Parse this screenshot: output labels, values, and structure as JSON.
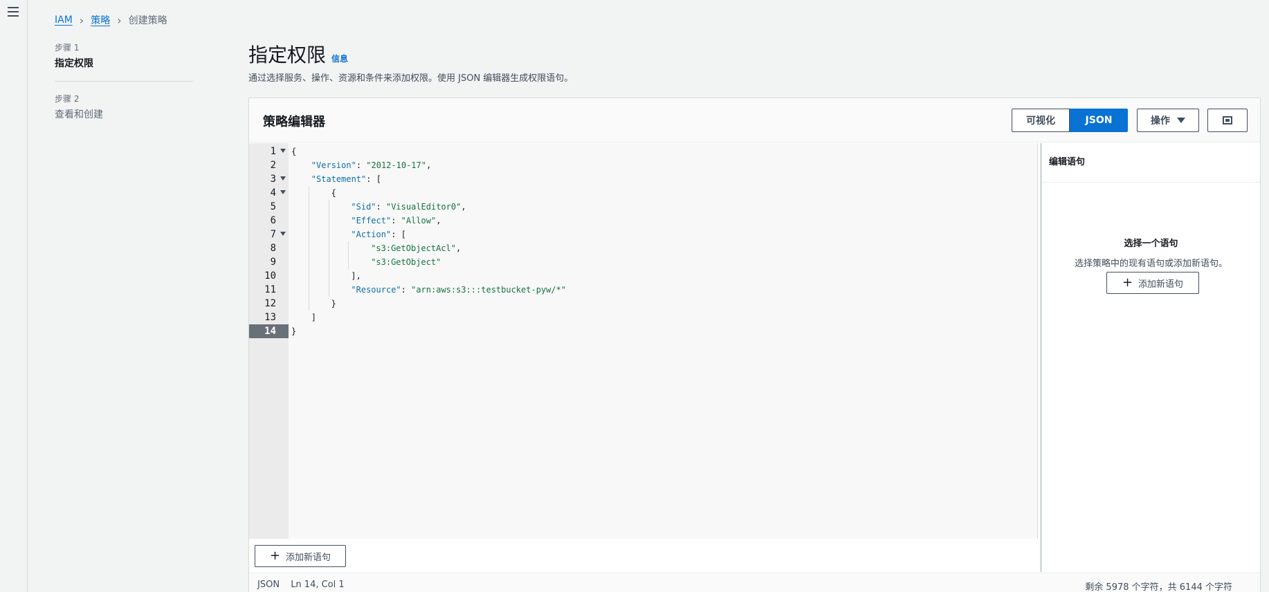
{
  "breadcrumb": {
    "iam": "IAM",
    "policies": "策略",
    "current": "创建策略"
  },
  "steps": [
    {
      "num": "步骤 1",
      "title": "指定权限"
    },
    {
      "num": "步骤 2",
      "title": "查看和创建"
    }
  ],
  "page": {
    "title": "指定权限",
    "info": "信息",
    "description": "通过选择服务、操作、资源和条件来添加权限。使用 JSON 编辑器生成权限语句。"
  },
  "editor": {
    "title": "策略编辑器",
    "tab_visual": "可视化",
    "tab_json": "JSON",
    "actions": "操作",
    "lines": [
      {
        "n": "1",
        "text": "{"
      },
      {
        "n": "2",
        "key": "\"Version\"",
        "sep": ": ",
        "val": "\"2012-10-17\"",
        "tail": ","
      },
      {
        "n": "3",
        "key": "\"Statement\"",
        "sep": ": [",
        "val": "",
        "tail": ""
      },
      {
        "n": "4",
        "text": "{"
      },
      {
        "n": "5",
        "key": "\"Sid\"",
        "sep": ": ",
        "val": "\"VisualEditor0\"",
        "tail": ","
      },
      {
        "n": "6",
        "key": "\"Effect\"",
        "sep": ": ",
        "val": "\"Allow\"",
        "tail": ","
      },
      {
        "n": "7",
        "key": "\"Action\"",
        "sep": ": [",
        "val": "",
        "tail": ""
      },
      {
        "n": "8",
        "val": "\"s3:GetObjectAcl\"",
        "tail": ","
      },
      {
        "n": "9",
        "val": "\"s3:GetObject\"",
        "tail": ""
      },
      {
        "n": "10",
        "text": "],"
      },
      {
        "n": "11",
        "key": "\"Resource\"",
        "sep": ": ",
        "val": "\"arn:aws:s3:::testbucket-pyw/*\"",
        "tail": ""
      },
      {
        "n": "12",
        "text": "}"
      },
      {
        "n": "13",
        "text": "]"
      },
      {
        "n": "14",
        "text": "}"
      }
    ],
    "add_statement": "添加新语句"
  },
  "side_panel": {
    "title": "编辑语句",
    "empty_title": "选择一个语句",
    "empty_desc": "选择策略中的现有语句或添加新语句。",
    "add_statement": "添加新语句"
  },
  "status": {
    "mode": "JSON",
    "position": "Ln 14, Col 1",
    "remaining": "剩余 5978 个字符，共 6144 个字符"
  },
  "colors": {
    "accent": "#0972d3",
    "key": "#0b6faa",
    "string": "#15733e"
  }
}
